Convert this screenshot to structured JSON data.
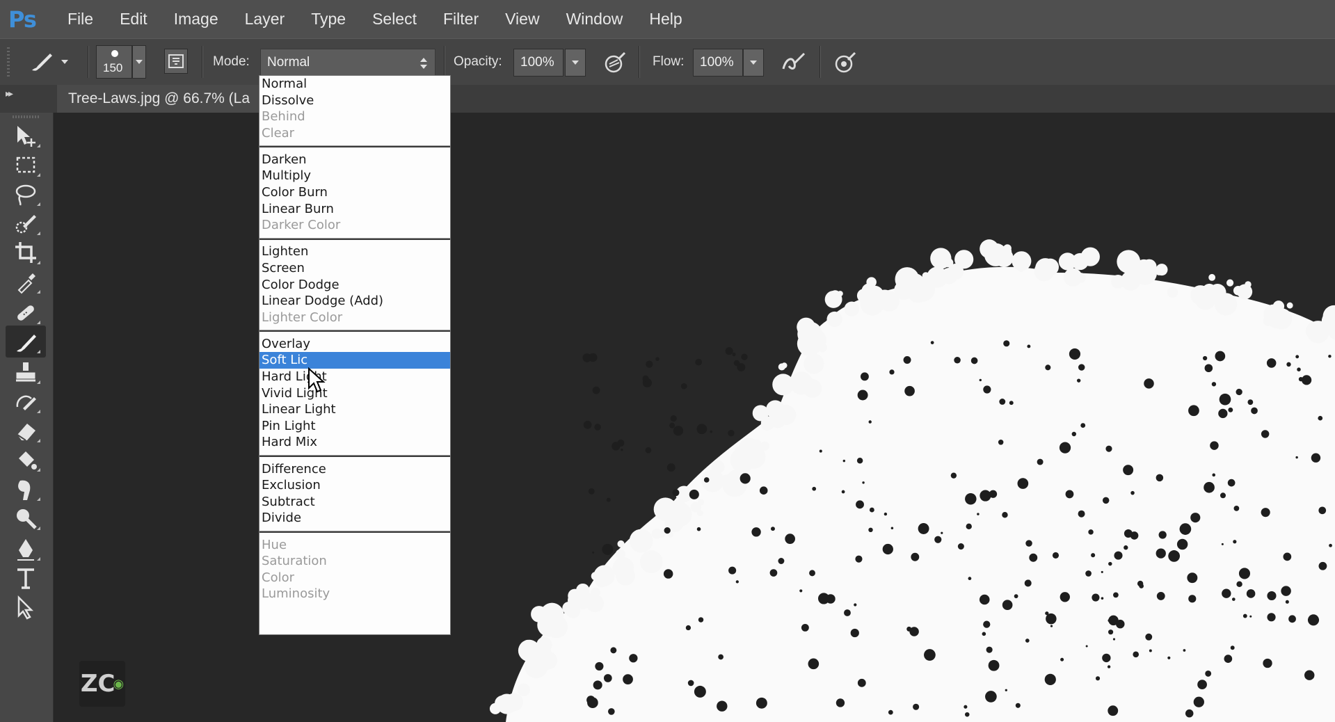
{
  "app": {
    "logo": "Ps"
  },
  "menu": [
    "File",
    "Edit",
    "Image",
    "Layer",
    "Type",
    "Select",
    "Filter",
    "View",
    "Window",
    "Help"
  ],
  "options_bar": {
    "tool_icon": "brush-icon",
    "brush_size": "150",
    "mode_label": "Mode:",
    "mode_value": "Normal",
    "opacity_label": "Opacity:",
    "opacity_value": "100%",
    "flow_label": "Flow:",
    "flow_value": "100%"
  },
  "document_tab": {
    "title": "Tree-Laws.jpg @ 66.7% (La"
  },
  "tools": [
    "move-tool-icon",
    "rectangular-marquee-icon",
    "lasso-icon",
    "quick-selection-icon",
    "crop-icon",
    "eyedropper-icon",
    "healing-brush-icon",
    "brush-icon",
    "clone-stamp-icon",
    "history-brush-icon",
    "eraser-icon",
    "paint-bucket-icon",
    "smudge-icon",
    "dodge-icon",
    "pen-icon",
    "type-icon",
    "path-selection-icon"
  ],
  "active_tool": "brush-icon",
  "blend_modes": [
    [
      {
        "label": "Normal",
        "enabled": true
      },
      {
        "label": "Dissolve",
        "enabled": true
      },
      {
        "label": "Behind",
        "enabled": false
      },
      {
        "label": "Clear",
        "enabled": false
      }
    ],
    [
      {
        "label": "Darken",
        "enabled": true
      },
      {
        "label": "Multiply",
        "enabled": true
      },
      {
        "label": "Color Burn",
        "enabled": true
      },
      {
        "label": "Linear Burn",
        "enabled": true
      },
      {
        "label": "Darker Color",
        "enabled": false
      }
    ],
    [
      {
        "label": "Lighten",
        "enabled": true
      },
      {
        "label": "Screen",
        "enabled": true
      },
      {
        "label": "Color Dodge",
        "enabled": true
      },
      {
        "label": "Linear Dodge (Add)",
        "enabled": true
      },
      {
        "label": "Lighter Color",
        "enabled": false
      }
    ],
    [
      {
        "label": "Overlay",
        "enabled": true
      },
      {
        "label": "Soft Lic",
        "enabled": true,
        "selected": true
      },
      {
        "label": "Hard Light",
        "enabled": true
      },
      {
        "label": "Vivid Light",
        "enabled": true
      },
      {
        "label": "Linear Light",
        "enabled": true
      },
      {
        "label": "Pin Light",
        "enabled": true
      },
      {
        "label": "Hard Mix",
        "enabled": true
      }
    ],
    [
      {
        "label": "Difference",
        "enabled": true
      },
      {
        "label": "Exclusion",
        "enabled": true
      },
      {
        "label": "Subtract",
        "enabled": true
      },
      {
        "label": "Divide",
        "enabled": true
      }
    ],
    [
      {
        "label": "Hue",
        "enabled": false
      },
      {
        "label": "Saturation",
        "enabled": false
      },
      {
        "label": "Color",
        "enabled": false
      },
      {
        "label": "Luminosity",
        "enabled": false
      }
    ]
  ],
  "watermark": {
    "text": "ZC"
  },
  "colors": {
    "accent": "#3b83d9",
    "menubar": "#4f4f4f",
    "optionsbar": "#444444",
    "canvas": "#272727"
  }
}
